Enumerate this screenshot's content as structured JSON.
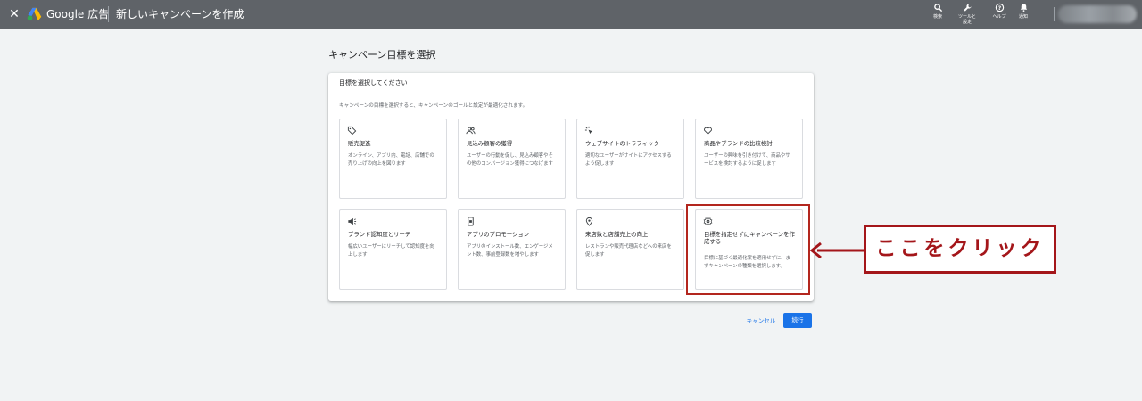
{
  "topbar": {
    "close_icon": "close-icon",
    "brand": "Google 広告",
    "page": "新しいキャンペーンを作成",
    "tools": [
      {
        "label": "検索",
        "icon": "search-icon"
      },
      {
        "label": "ツールと\n設定",
        "icon": "wrench-icon"
      },
      {
        "label": "ヘルプ",
        "icon": "help-icon"
      },
      {
        "label": "通知",
        "icon": "bell-icon"
      }
    ]
  },
  "main": {
    "title": "キャンペーン目標を選択",
    "panel_header": "目標を選択してください",
    "description": "キャンペーンの目標を選択すると、キャンペーンのゴールと設定が最適化されます。",
    "cards": [
      {
        "icon": "tag-icon",
        "title": "販売促進",
        "desc": "オンライン、アプリ内、電話、店舗での売り上げの向上を図ります"
      },
      {
        "icon": "people-icon",
        "title": "見込み顧客の獲得",
        "desc": "ユーザーの行動を促し、見込み顧客やその他のコンバージョン獲得につなげます"
      },
      {
        "icon": "cursor-click-icon",
        "title": "ウェブサイトのトラフィック",
        "desc": "適切なユーザーがサイトにアクセスするよう促します"
      },
      {
        "icon": "heart-icon",
        "title": "商品やブランドの比較検討",
        "desc": "ユーザーの興味を引き付けて、商品やサービスを検討するように促します"
      },
      {
        "icon": "megaphone-icon",
        "title": "ブランド認知度とリーチ",
        "desc": "幅広いユーザーにリーチして認知度を向上します"
      },
      {
        "icon": "smartphone-icon",
        "title": "アプリのプロモーション",
        "desc": "アプリのインストール数、エンゲージメント数、事前登録数を増やします"
      },
      {
        "icon": "location-pin-icon",
        "title": "来店数と店舗売上の向上",
        "desc": "レストランや販売代理店などへの来店を促します"
      },
      {
        "icon": "gear-icon",
        "title": "目標を指定せずにキャンペーンを作成する",
        "desc": "目標に基づく最適化案を適用せずに、まずキャンペーンの種類を選択します。"
      }
    ],
    "cancel_label": "キャンセル",
    "continue_label": "続行"
  },
  "annotation": {
    "callout": "ここをクリック"
  },
  "colors": {
    "topbar": "#5f6368",
    "background": "#f1f3f4",
    "accent": "#1a73e8",
    "annotation_red": "#a4161a"
  }
}
